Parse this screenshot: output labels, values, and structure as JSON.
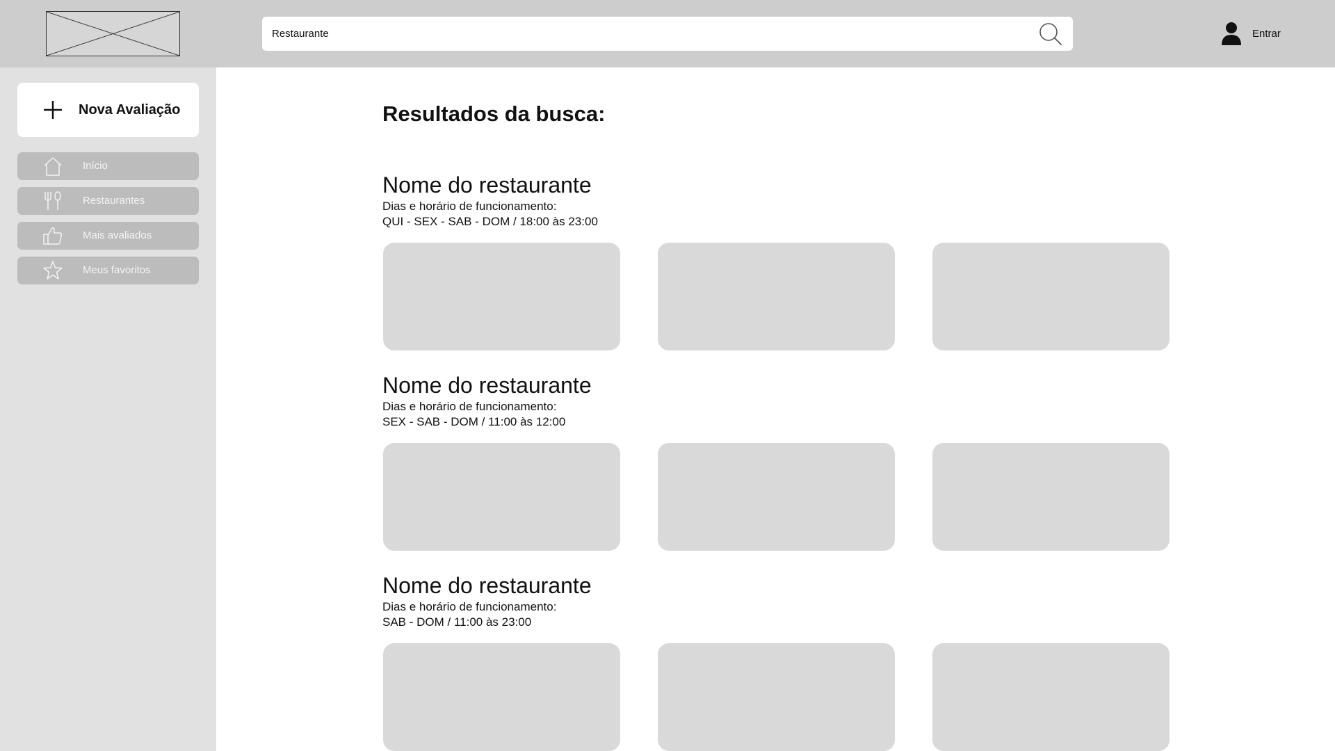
{
  "header": {
    "logo_icon": "image-placeholder-icon",
    "search": {
      "value": "Restaurante",
      "placeholder": "",
      "icon": "search-icon"
    },
    "user": {
      "icon": "user-icon",
      "label": "Entrar"
    }
  },
  "sidebar": {
    "new_review": {
      "icon": "plus-icon",
      "label": "Nova Avaliação"
    },
    "items": [
      {
        "icon": "home-icon",
        "label": "Início"
      },
      {
        "icon": "fork-spoon-icon",
        "label": "Restaurantes"
      },
      {
        "icon": "thumbs-up-icon",
        "label": "Mais avaliados"
      },
      {
        "icon": "star-icon",
        "label": "Meus favoritos"
      }
    ]
  },
  "main": {
    "title": "Resultados da busca:",
    "results": [
      {
        "name": "Nome do restaurante",
        "hours_label": "Dias e horário de funcionamento:",
        "hours": "QUI - SEX - SAB - DOM / 18:00 às 23:00"
      },
      {
        "name": "Nome do restaurante",
        "hours_label": "Dias e horário de funcionamento:",
        "hours": "SEX - SAB - DOM / 11:00 às 12:00"
      },
      {
        "name": "Nome do restaurante",
        "hours_label": "Dias e horário de funcionamento:",
        "hours": "SAB - DOM / 11:00 às 23:00"
      }
    ]
  },
  "colors": {
    "header_bg": "#cdcdcd",
    "sidebar_bg": "#e1e1e1",
    "nav_item_bg": "#bcbcbc",
    "photo_placeholder": "#d9d9d9"
  }
}
